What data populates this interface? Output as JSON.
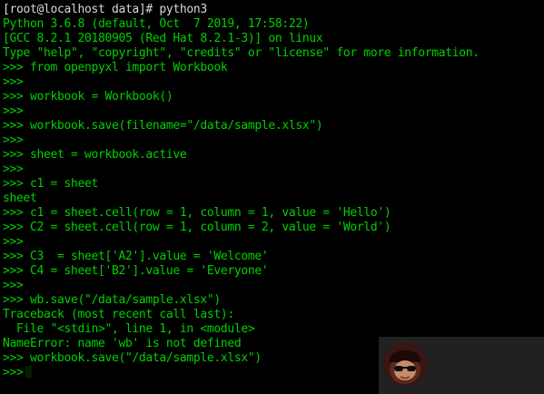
{
  "terminal": {
    "lines": [
      {
        "text": "[root@localhost data]# python3",
        "kind": "out-white"
      },
      {
        "text": "Python 3.6.8 (default, Oct  7 2019, 17:58:22)",
        "kind": "out-green"
      },
      {
        "text": "[GCC 8.2.1 20180905 (Red Hat 8.2.1-3)] on linux",
        "kind": "out-green"
      },
      {
        "text": "Type \"help\", \"copyright\", \"credits\" or \"license\" for more information.",
        "kind": "out-green"
      },
      {
        "text": ">>> from openpyxl import Workbook",
        "kind": "out-green"
      },
      {
        "text": ">>>",
        "kind": "out-green"
      },
      {
        "text": ">>> workbook = Workbook()",
        "kind": "out-green"
      },
      {
        "text": ">>>",
        "kind": "out-green"
      },
      {
        "text": ">>> workbook.save(filename=\"/data/sample.xlsx\")",
        "kind": "out-green"
      },
      {
        "text": ">>>",
        "kind": "out-green"
      },
      {
        "text": ">>> sheet = workbook.active",
        "kind": "out-green"
      },
      {
        "text": ">>>",
        "kind": "out-green"
      },
      {
        "text": ">>> c1 = sheet",
        "kind": "out-green"
      },
      {
        "text": "sheet",
        "kind": "out-green"
      },
      {
        "text": ">>> c1 = sheet.cell(row = 1, column = 1, value = 'Hello')",
        "kind": "out-green"
      },
      {
        "text": ">>> C2 = sheet.cell(row = 1, column = 2, value = 'World')",
        "kind": "out-green"
      },
      {
        "text": ">>>",
        "kind": "out-green"
      },
      {
        "text": ">>> C3  = sheet['A2'].value = 'Welcome'",
        "kind": "out-green"
      },
      {
        "text": ">>> C4 = sheet['B2'].value = 'Everyone'",
        "kind": "out-green"
      },
      {
        "text": ">>>",
        "kind": "out-green"
      },
      {
        "text": ">>> wb.save(\"/data/sample.xlsx\")",
        "kind": "out-green"
      },
      {
        "text": "Traceback (most recent call last):",
        "kind": "out-green"
      },
      {
        "text": "  File \"<stdin>\", line 1, in <module>",
        "kind": "out-green"
      },
      {
        "text": "NameError: name 'wb' is not defined",
        "kind": "out-green"
      },
      {
        "text": ">>> workbook.save(\"/data/sample.xlsx\")",
        "kind": "out-green"
      },
      {
        "text": ">>>",
        "kind": "out-green"
      }
    ]
  },
  "colors": {
    "background": "#000000",
    "prompt_text": "#d8d8d8",
    "output_text": "#00d000"
  },
  "icons": {
    "avatar": "sunglasses-avatar-icon"
  }
}
